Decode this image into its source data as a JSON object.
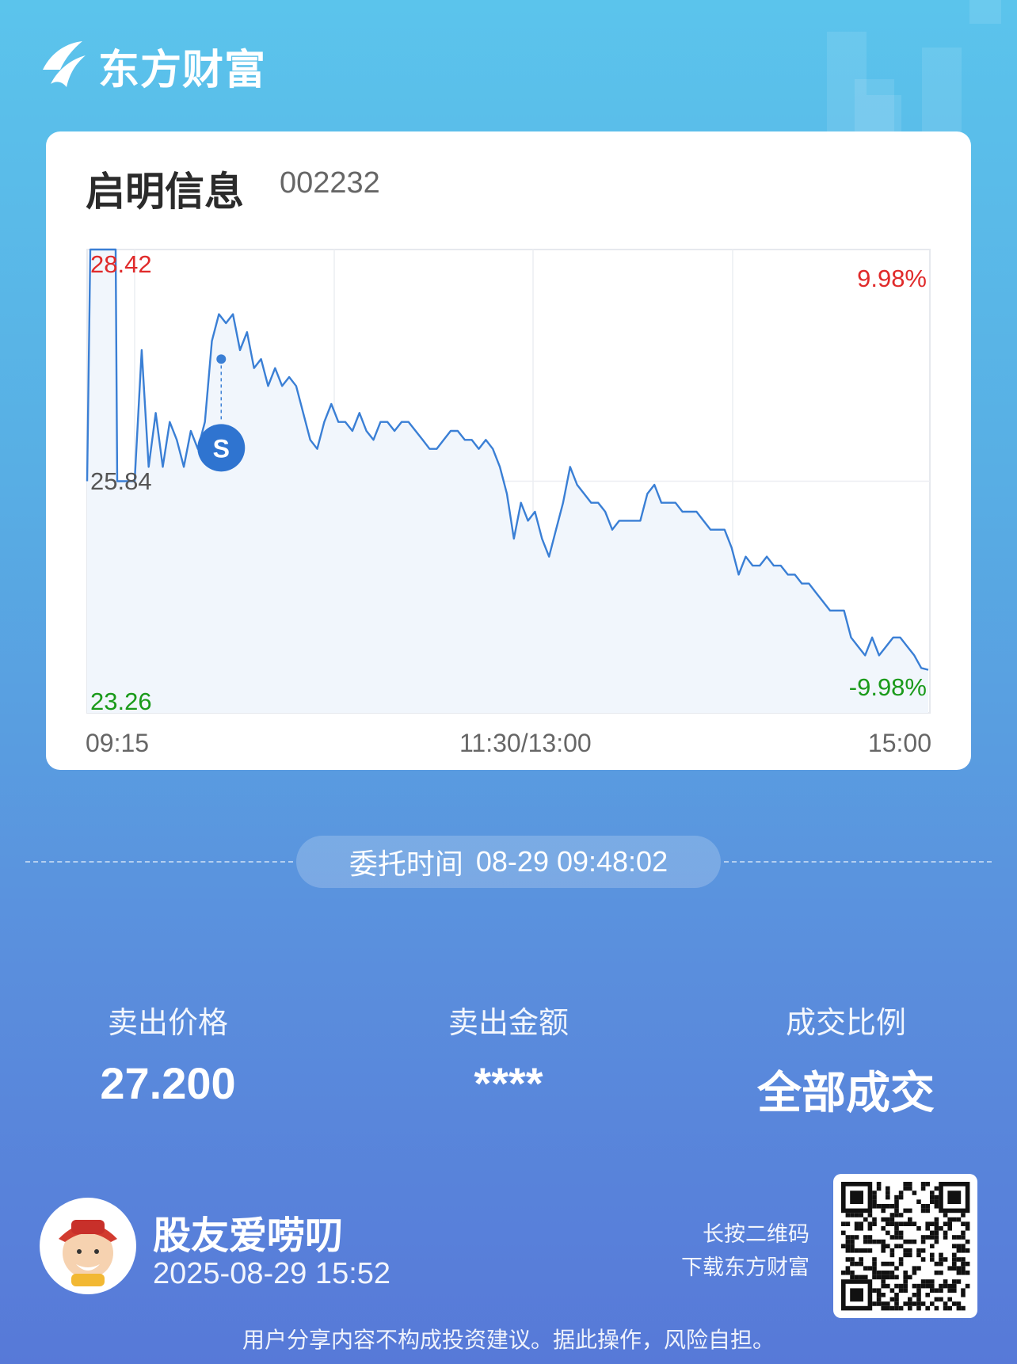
{
  "brand": {
    "name": "东方财富",
    "logo_icon": "eastmoney-logo-icon"
  },
  "stock": {
    "name": "启明信息",
    "code": "002232"
  },
  "chart_data": {
    "type": "line",
    "title": "",
    "x_ticks": [
      "09:15",
      "11:30/13:00",
      "15:00"
    ],
    "y_left_labels": {
      "high": "28.42",
      "mid": "25.84",
      "low": "23.26"
    },
    "y_right_labels": {
      "high": "9.98%",
      "low": "-9.98%"
    },
    "ylim": [
      23.26,
      28.42
    ],
    "prev_close": 25.84,
    "line_color": "#3a7fd5",
    "fill_color": "#f1f6fc",
    "grid": true,
    "auction_prices": [
      25.84,
      28.42,
      28.42,
      25.84,
      25.84
    ],
    "prices": [
      25.84,
      27.3,
      26.0,
      26.6,
      26.0,
      26.5,
      26.3,
      26.0,
      26.4,
      26.2,
      26.5,
      27.4,
      27.7,
      27.6,
      27.7,
      27.3,
      27.5,
      27.1,
      27.2,
      26.9,
      27.1,
      26.9,
      27.0,
      26.9,
      26.6,
      26.3,
      26.2,
      26.5,
      26.7,
      26.5,
      26.5,
      26.4,
      26.6,
      26.4,
      26.3,
      26.5,
      26.5,
      26.4,
      26.5,
      26.5,
      26.4,
      26.3,
      26.2,
      26.2,
      26.3,
      26.4,
      26.4,
      26.3,
      26.3,
      26.2,
      26.3,
      26.2,
      26.0,
      25.7,
      25.2,
      25.6,
      25.4,
      25.5,
      25.2,
      25.0,
      25.3,
      25.6,
      26.0,
      25.8,
      25.7,
      25.6,
      25.6,
      25.5,
      25.3,
      25.4,
      25.4,
      25.4,
      25.4,
      25.7,
      25.8,
      25.6,
      25.6,
      25.6,
      25.5,
      25.5,
      25.5,
      25.4,
      25.3,
      25.3,
      25.3,
      25.1,
      24.8,
      25.0,
      24.9,
      24.9,
      25.0,
      24.9,
      24.9,
      24.8,
      24.8,
      24.7,
      24.7,
      24.6,
      24.5,
      24.4,
      24.4,
      24.4,
      24.1,
      24.0,
      23.9,
      24.1,
      23.9,
      24.0,
      24.1,
      24.1,
      24.0,
      23.9,
      23.76,
      23.74
    ]
  },
  "marker": {
    "label": "S",
    "price": 27.2
  },
  "order_time": {
    "label": "委托时间",
    "value": "08-29 09:48:02"
  },
  "stats": [
    {
      "label": "卖出价格",
      "value": "27.200"
    },
    {
      "label": "卖出金额",
      "value": "****"
    },
    {
      "label": "成交比例",
      "value": "全部成交"
    }
  ],
  "user": {
    "name": "股友爱唠叨",
    "time": "2025-08-29 15:52",
    "avatar_icon": "avatar-icon"
  },
  "download_hint": {
    "line1": "长按二维码",
    "line2": "下载东方财富"
  },
  "disclaimer": "用户分享内容不构成投资建议。据此操作，风险自担。"
}
